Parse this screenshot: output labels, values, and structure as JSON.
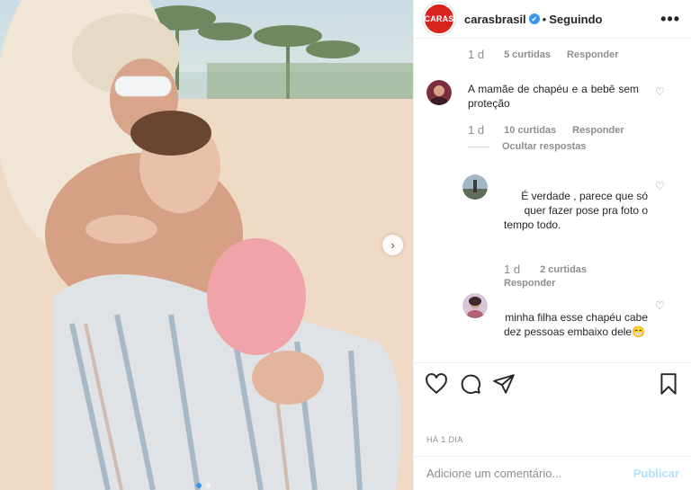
{
  "post": {
    "author": "carasbrasil",
    "logo_text": "CARAS",
    "follow_status": "Seguindo",
    "separator": "•",
    "verified_glyph": "✔",
    "more_glyph": "•••",
    "date": "HÁ 1 DIA",
    "carousel_next_glyph": "›",
    "slide_count": 2,
    "active_slide": 1
  },
  "comments": [
    {
      "time": "1 d",
      "likes": "5 curtidas",
      "reply": "Responder"
    },
    {
      "text": "A mamãe de chapéu e a bebê sem proteção",
      "time": "1 d",
      "likes": "10 curtidas",
      "reply": "Responder",
      "hide_replies": "Ocultar respostas"
    }
  ],
  "replies": [
    {
      "text": "É verdade , parece que só quer fazer pose pra foto o tempo todo.",
      "time": "1 d",
      "likes": "2 curtidas",
      "reply": "Responder"
    },
    {
      "text": "minha filha esse chapéu cabe dez pessoas embaixo dele😁"
    }
  ],
  "composer": {
    "placeholder": "Adicione um comentário...",
    "publish": "Publicar"
  },
  "icons": {
    "like": "heart-icon",
    "comment": "comment-icon",
    "share": "share-icon",
    "save": "bookmark-icon",
    "comment_like": "small-heart-icon",
    "heart_glyph": "♡"
  },
  "colors": {
    "brand": "#d9231f",
    "link": "#3897f0",
    "publish_disabled": "#b2dffc",
    "muted": "#8e8e8e"
  }
}
